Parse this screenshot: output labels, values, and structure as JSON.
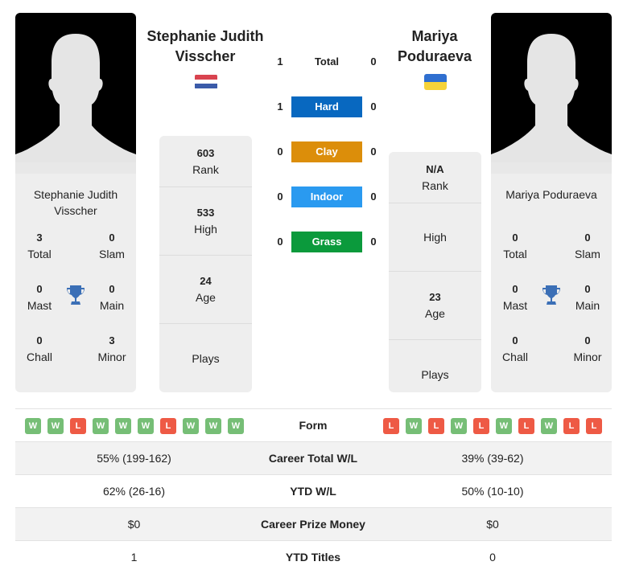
{
  "player1": {
    "name": "Stephanie Judith Visscher",
    "name_line1": "Stephanie Judith",
    "name_line2": "Visscher",
    "flag": "netherlands-flag",
    "flag_colors": [
      "#ae1c28",
      "#ffffff",
      "#21468b"
    ],
    "titles": {
      "total": {
        "value": "3",
        "label": "Total"
      },
      "slam": {
        "value": "0",
        "label": "Slam"
      },
      "mast": {
        "value": "0",
        "label": "Mast"
      },
      "main": {
        "value": "0",
        "label": "Main"
      },
      "chall": {
        "value": "0",
        "label": "Chall"
      },
      "minor": {
        "value": "3",
        "label": "Minor"
      }
    },
    "stats": {
      "rank": {
        "value": "603",
        "label": "Rank"
      },
      "high": {
        "value": "533",
        "label": "High"
      },
      "age": {
        "value": "24",
        "label": "Age"
      },
      "plays": {
        "value": "",
        "label": "Plays"
      }
    },
    "form": [
      "W",
      "W",
      "L",
      "W",
      "W",
      "W",
      "L",
      "W",
      "W",
      "W"
    ],
    "career_wl": "55% (199-162)",
    "ytd_wl": "62% (26-16)",
    "prize_money": "$0",
    "ytd_titles": "1"
  },
  "player2": {
    "name": "Mariya Poduraeva",
    "name_line1": "Mariya",
    "name_line2": "Poduraeva",
    "flag": "ukraine-flag",
    "flag_colors": [
      "#0057b7",
      "#ffd700"
    ],
    "titles": {
      "total": {
        "value": "0",
        "label": "Total"
      },
      "slam": {
        "value": "0",
        "label": "Slam"
      },
      "mast": {
        "value": "0",
        "label": "Mast"
      },
      "main": {
        "value": "0",
        "label": "Main"
      },
      "chall": {
        "value": "0",
        "label": "Chall"
      },
      "minor": {
        "value": "0",
        "label": "Minor"
      }
    },
    "stats": {
      "rank": {
        "value": "N/A",
        "label": "Rank"
      },
      "high": {
        "value": "",
        "label": "High"
      },
      "age": {
        "value": "23",
        "label": "Age"
      },
      "plays": {
        "value": "",
        "label": "Plays"
      }
    },
    "form": [
      "L",
      "W",
      "L",
      "W",
      "L",
      "W",
      "L",
      "W",
      "L",
      "L"
    ],
    "career_wl": "39% (39-62)",
    "ytd_wl": "50% (10-10)",
    "prize_money": "$0",
    "ytd_titles": "0"
  },
  "h2h": [
    {
      "label": "Total",
      "p1": "1",
      "p2": "0",
      "color": ""
    },
    {
      "label": "Hard",
      "p1": "1",
      "p2": "0",
      "color": "#0868c0"
    },
    {
      "label": "Clay",
      "p1": "0",
      "p2": "0",
      "color": "#dc8e0a"
    },
    {
      "label": "Indoor",
      "p1": "0",
      "p2": "0",
      "color": "#2a9af0"
    },
    {
      "label": "Grass",
      "p1": "0",
      "p2": "0",
      "color": "#0b9a3c"
    }
  ],
  "comparison": {
    "form_label": "Form",
    "career_wl_label": "Career Total W/L",
    "ytd_wl_label": "YTD W/L",
    "prize_label": "Career Prize Money",
    "ytd_titles_label": "YTD Titles"
  },
  "colors": {
    "win": "#76be76",
    "loss": "#ee5a45",
    "trophy": "#3b6fb6"
  }
}
